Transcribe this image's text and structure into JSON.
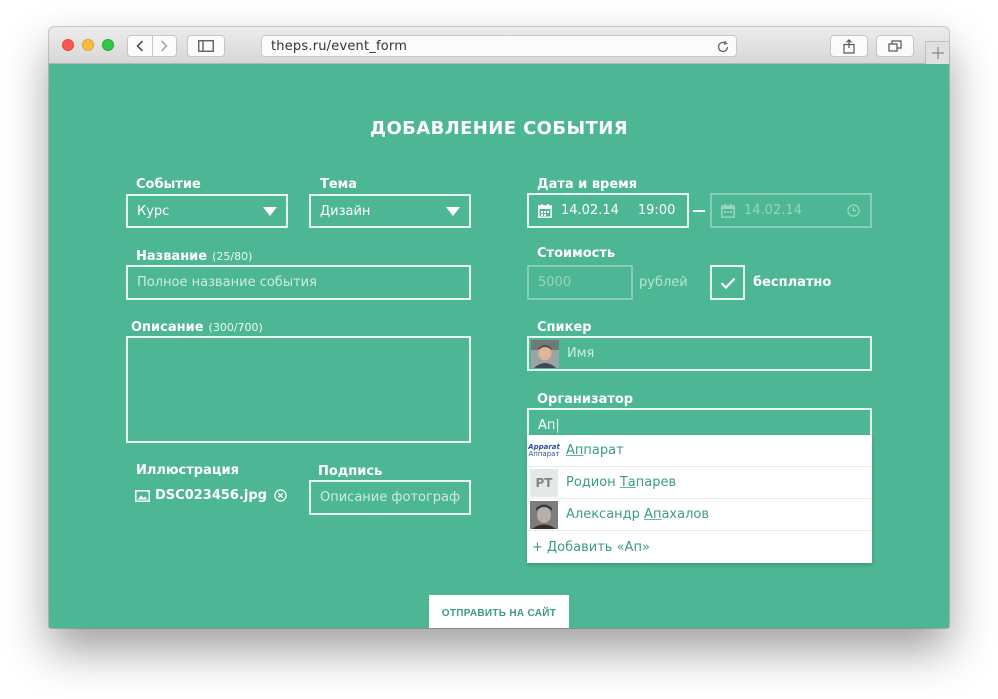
{
  "browser": {
    "url": "theps.ru/event_form"
  },
  "form": {
    "title": "ДОБАВЛЕНИЕ СОБЫТИЯ",
    "event": {
      "label": "Событие",
      "value": "Курс"
    },
    "topic": {
      "label": "Тема",
      "value": "Дизайн"
    },
    "name": {
      "label": "Название",
      "count": "(25/80)",
      "placeholder": "Полное название события"
    },
    "description": {
      "label": "Описание",
      "count": "(300/700)",
      "value": ""
    },
    "illustration": {
      "label": "Иллюстрация",
      "filename": "DSC023456.jpg"
    },
    "caption": {
      "label": "Подпись",
      "placeholder": "Описание фотограф"
    },
    "datetime": {
      "label": "Дата и время",
      "start_date": "14.02.14",
      "start_time": "19:00",
      "end_date": "14.02.14"
    },
    "cost": {
      "label": "Стоимость",
      "placeholder": "5000",
      "currency": "рублей",
      "free_label": "бесплатно",
      "free_checked": true
    },
    "speaker": {
      "label": "Спикер",
      "placeholder": "Имя"
    },
    "organizer": {
      "label": "Организатор",
      "value": "Ап|",
      "suggestions": [
        {
          "match": "Ап",
          "rest": "парат",
          "prefix": ""
        },
        {
          "match": "Та",
          "rest": "парев",
          "prefix": "Родион "
        },
        {
          "match": "Ап",
          "rest": "ахалов",
          "prefix": "Александр "
        }
      ],
      "rt_initials": "РТ",
      "logo_text_top": "Apparat",
      "logo_text_bottom": "Аппарат",
      "add_label": "+ Добавить «Ап»"
    },
    "submit_label": "ОТПРАВИТЬ НА САЙТ"
  },
  "colors": {
    "page_bg": "#4db795",
    "link": "#3a9d7e"
  }
}
